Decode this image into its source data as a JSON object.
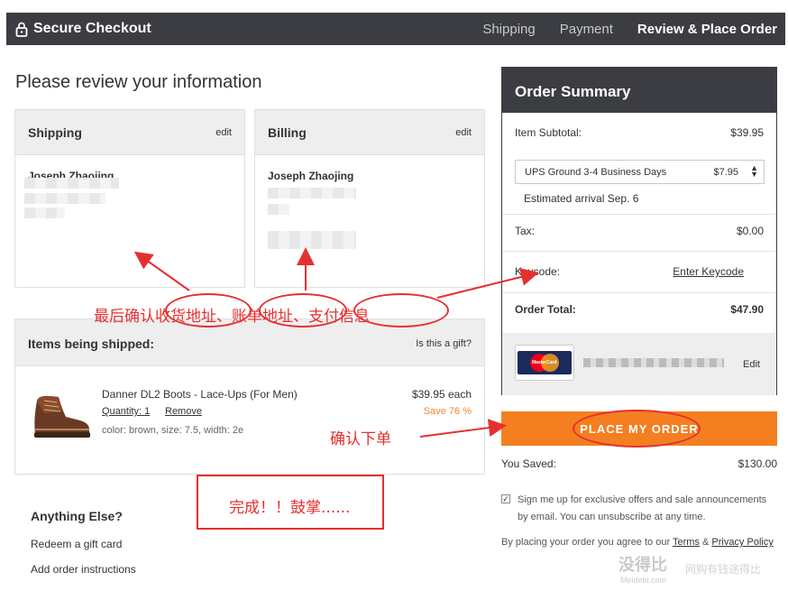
{
  "header": {
    "title": "Secure Checkout",
    "steps": [
      "Shipping",
      "Payment",
      "Review & Place Order"
    ],
    "active_step": 2
  },
  "page": {
    "title": "Please review your information"
  },
  "shipping": {
    "title": "Shipping",
    "edit": "edit",
    "name": "Joseph Zhaojing"
  },
  "billing": {
    "title": "Billing",
    "edit": "edit",
    "name": "Joseph Zhaojing"
  },
  "items": {
    "title": "Items being shipped:",
    "gift": "Is this a gift?",
    "product": {
      "name": "Danner DL2 Boots - Lace-Ups (For Men)",
      "quantity": "Quantity: 1",
      "remove": "Remove",
      "attrs": "color: brown, size: 7.5, width: 2e",
      "price": "$39.95 each",
      "save": "Save 76 %"
    }
  },
  "extras": {
    "title": "Anything Else?",
    "gift_card": "Redeem a gift card",
    "instructions": "Add order instructions"
  },
  "summary": {
    "title": "Order Summary",
    "subtotal_label": "Item Subtotal:",
    "subtotal": "$39.95",
    "shipping_option": "UPS Ground 3-4 Business Days",
    "shipping_price": "$7.95",
    "arrival": "Estimated arrival Sep. 6",
    "tax_label": "Tax:",
    "tax": "$0.00",
    "keycode_label": "Keycode:",
    "keycode_link": "Enter Keycode",
    "total_label": "Order Total:",
    "total": "$47.90",
    "payment_edit": "Edit",
    "card_brand": "MasterCard"
  },
  "place_order": "PLACE MY ORDER",
  "saved": {
    "label": "You Saved:",
    "value": "$130.00"
  },
  "signup": "Sign me up for exclusive offers and sale announcements by email. You can unsubscribe at any time.",
  "terms": {
    "prefix": "By placing your order you agree to our ",
    "terms": "Terms",
    "amp": " & ",
    "privacy": "Privacy Policy"
  },
  "annotations": {
    "confirm_info": "最后确认收货地址、账单地址、支付信息",
    "confirm_order": "确认下单",
    "done": "完成！！鼓掌......"
  },
  "watermark": {
    "main": "没得比",
    "sub": "Meidebi.com",
    "tagline": "网购有钱途得比"
  },
  "colors": {
    "dark": "#3b3d42",
    "accent": "#f47f20",
    "annotation": "#e53030",
    "save": "#f0862a"
  }
}
